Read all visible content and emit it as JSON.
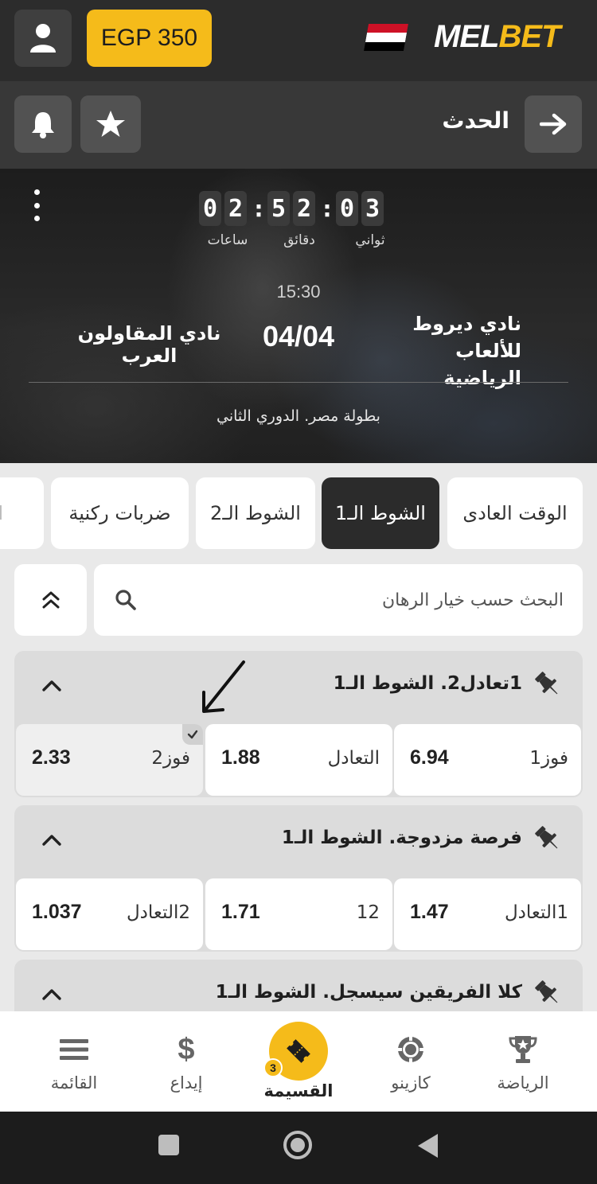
{
  "header": {
    "balance": "EGP 350",
    "logo_part1": "MEL",
    "logo_part2": "BET",
    "flag_colors": [
      "#ce1126",
      "#ffffff",
      "#000000"
    ]
  },
  "subheader": {
    "title": "الحدث"
  },
  "hero": {
    "countdown": {
      "hours": [
        "0",
        "2"
      ],
      "minutes": [
        "5",
        "2"
      ],
      "seconds": [
        "0",
        "3"
      ],
      "hours_label": "ساعات",
      "minutes_label": "دقائق",
      "seconds_label": "ثواني"
    },
    "match_time": "15:30",
    "score": "04/04",
    "home_team_line1": "نادي ديروط للألعاب",
    "home_team_line2": "الرياضية",
    "away_team": "نادي المقاولون العرب",
    "league": "بطولة مصر. الدوري الثاني"
  },
  "tabs": [
    {
      "label": "الوقت العادى",
      "active": false
    },
    {
      "label": "الشوط الـ1",
      "active": true
    },
    {
      "label": "الشوط الـ2",
      "active": false
    },
    {
      "label": "ضربات ركنية",
      "active": false
    },
    {
      "label": "ال",
      "active": false
    }
  ],
  "search": {
    "placeholder": "البحث حسب خيار الرهان"
  },
  "markets": [
    {
      "title": "1تعادل2. الشوط الـ1",
      "odds": [
        {
          "label": "فوز1",
          "value": "6.94"
        },
        {
          "label": "التعادل",
          "value": "1.88"
        },
        {
          "label": "فوز2",
          "value": "2.33",
          "selected": true
        }
      ]
    },
    {
      "title": "فرصة مزدوجة. الشوط الـ1",
      "odds": [
        {
          "label": "1التعادل",
          "value": "1.47"
        },
        {
          "label": "12",
          "value": "1.71"
        },
        {
          "label": "2التعادل",
          "value": "1.037"
        }
      ]
    },
    {
      "title": "كلا الفريقين سيسجل. الشوط الـ1"
    }
  ],
  "bottom_nav": {
    "sports": "الرياضة",
    "casino": "كازينو",
    "coupon": "القسيمة",
    "coupon_count": "3",
    "deposit": "إيداع",
    "menu": "القائمة"
  },
  "colors": {
    "accent": "#f5bb1a",
    "header_bg": "#2c2c2c",
    "active_tab": "#2b2b2b"
  }
}
